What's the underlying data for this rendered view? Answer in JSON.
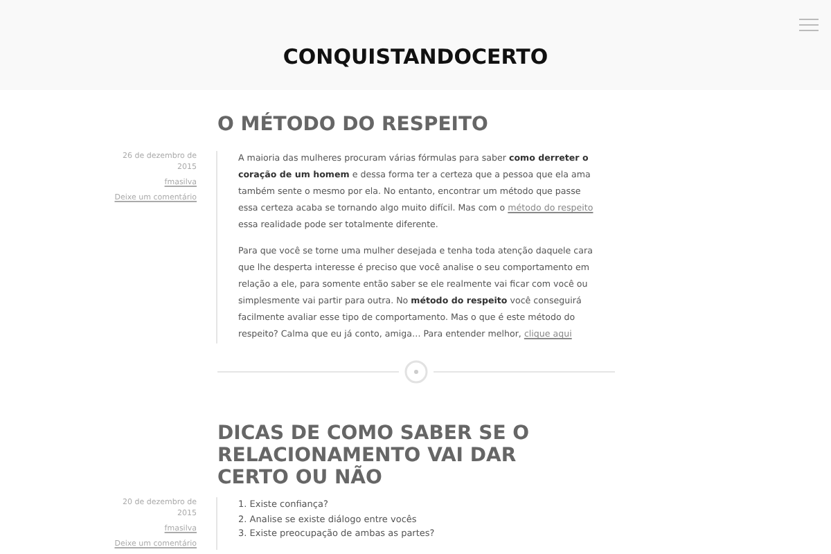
{
  "site_title": "CONQUISTANDOCERTO",
  "posts": [
    {
      "title": "O MÉTODO DO RESPEITO",
      "date": "26 de dezembro de 2015",
      "author": "fmasilva",
      "comments": "Deixe um comentário",
      "kind": "paragraphs",
      "paragraphs": [
        [
          {
            "kind": "plain",
            "text": "A maioria das mulheres procuram várias fórmulas para saber "
          },
          {
            "kind": "bold",
            "text": "como derreter o coração de um homem"
          },
          {
            "kind": "plain",
            "text": " e dessa forma ter a certeza que a pessoa que ela ama também sente o mesmo por ela. No entanto, encontrar um método que passe essa certeza acaba se tornando algo muito difícil. Mas com o "
          },
          {
            "kind": "link",
            "text": "método do respeito"
          },
          {
            "kind": "plain",
            "text": " essa realidade pode ser totalmente diferente."
          }
        ],
        [
          {
            "kind": "plain",
            "text": "Para que você se torne uma mulher desejada e tenha toda atenção daquele cara que lhe desperta interesse é preciso que você analise o seu comportamento em relação a ele, para somente então saber se ele realmente vai ficar com você ou simplesmente vai partir para outra. No "
          },
          {
            "kind": "bold",
            "text": "método do respeito"
          },
          {
            "kind": "plain",
            "text": " você conseguirá facilmente avaliar esse tipo de comportamento. Mas o que é este método do respeito? Calma que eu já conto, amiga… Para entender melhor, "
          },
          {
            "kind": "link",
            "text": "clique aqui"
          }
        ]
      ]
    },
    {
      "title": "DICAS DE COMO SABER SE O RELACIONAMENTO VAI DAR CERTO OU NÃO",
      "date": "20 de dezembro de 2015",
      "author": "fmasilva",
      "comments": "Deixe um comentário",
      "kind": "list",
      "items": [
        "1. Existe confiança?",
        "2. Analise se existe diálogo entre vocês",
        "3. Existe preocupação de ambas as partes?"
      ]
    }
  ]
}
